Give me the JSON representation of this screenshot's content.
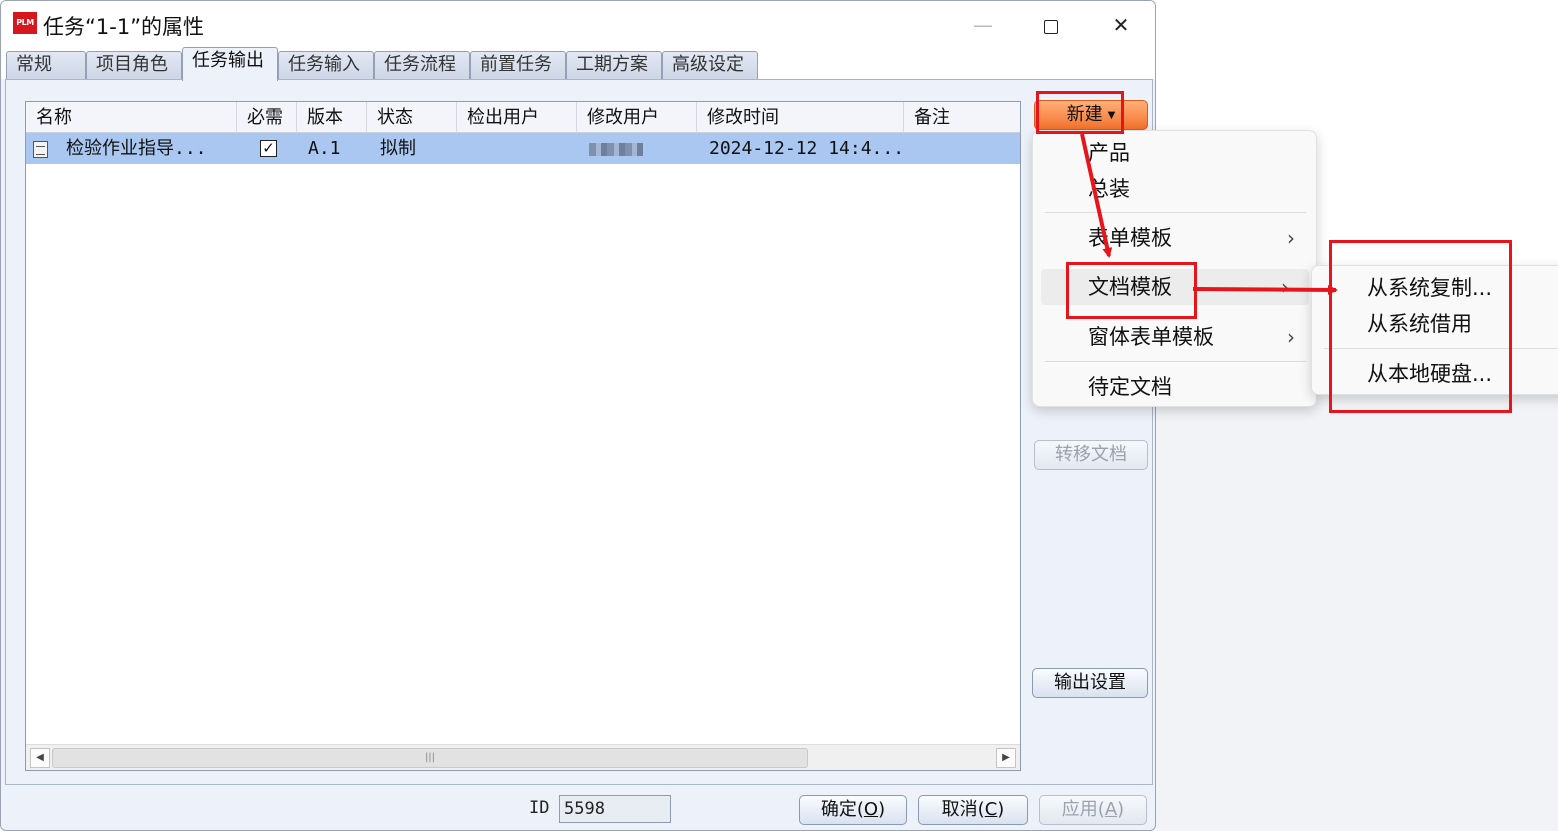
{
  "window": {
    "app_logo": "PLM",
    "title": "任务“1-1”的属性"
  },
  "tabs": [
    {
      "label": "常规"
    },
    {
      "label": "项目角色"
    },
    {
      "label": "任务输出"
    },
    {
      "label": "任务输入"
    },
    {
      "label": "任务流程"
    },
    {
      "label": "前置任务"
    },
    {
      "label": "工期方案"
    },
    {
      "label": "高级设定"
    }
  ],
  "active_tab": "任务输出",
  "table": {
    "columns": [
      "名称",
      "必需",
      "版本",
      "状态",
      "检出用户",
      "修改用户",
      "修改时间",
      "备注"
    ],
    "rows": [
      {
        "name": "检验作业指导...",
        "required": true,
        "version": "A.1",
        "status": "拟制",
        "checkout_user": "",
        "modify_user": "",
        "modify_time": "2024-12-12 14:4...",
        "remark": ""
      }
    ]
  },
  "buttons": {
    "new": "新建",
    "transfer_doc": "转移文档",
    "output_settings": "输出设置",
    "ok": "确定(O)",
    "ok_mnemonic": "O",
    "cancel": "取消(C)",
    "cancel_mnemonic": "C",
    "apply": "应用(A)",
    "apply_mnemonic": "A"
  },
  "id_field": {
    "label": "ID",
    "value": "5598"
  },
  "new_menu": {
    "items": [
      {
        "label": "产品",
        "has_submenu": false
      },
      {
        "label": "总装",
        "has_submenu": false
      },
      {
        "label": "表单模板",
        "has_submenu": true
      },
      {
        "label": "文档模板",
        "has_submenu": true,
        "highlighted": true
      },
      {
        "label": "窗体表单模板",
        "has_submenu": true
      },
      {
        "label": "待定文档",
        "has_submenu": false
      }
    ]
  },
  "doc_template_submenu": {
    "items": [
      {
        "label": "从系统复制..."
      },
      {
        "label": "从系统借用"
      },
      {
        "label": "从本地硬盘..."
      }
    ]
  },
  "colors": {
    "annotation_red": "#e8141c",
    "selected_row": "#a9c7f0",
    "new_button": "#f4722d"
  }
}
